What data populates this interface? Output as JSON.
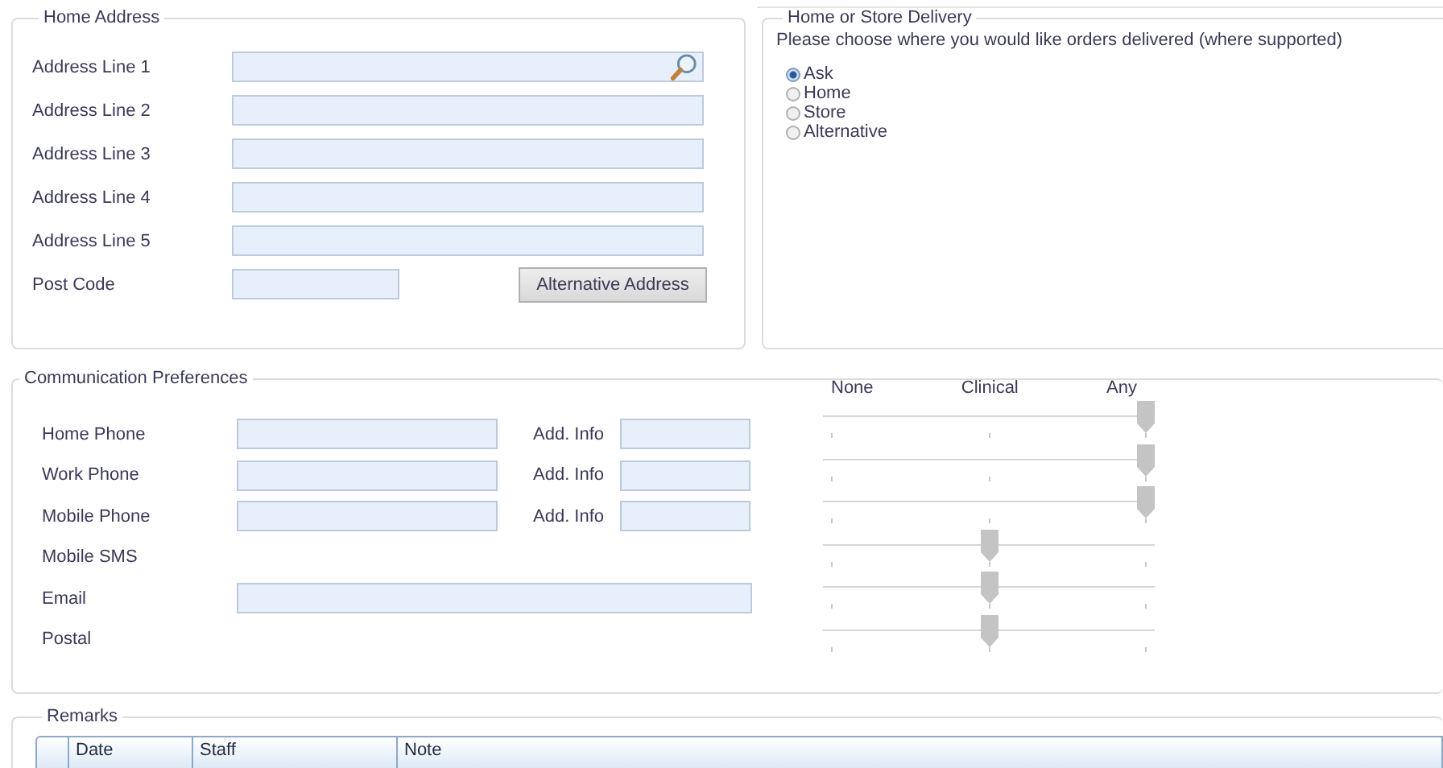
{
  "home_address": {
    "title": "Home Address",
    "fields": [
      {
        "label": "Address Line 1",
        "kind": "search"
      },
      {
        "label": "Address Line 2",
        "kind": "text"
      },
      {
        "label": "Address Line 3",
        "kind": "text"
      },
      {
        "label": "Address Line 4",
        "kind": "text"
      },
      {
        "label": "Address Line 5",
        "kind": "text"
      }
    ],
    "postcode_label": "Post Code",
    "button": "Alternative Address"
  },
  "delivery": {
    "title": "Home or Store Delivery",
    "prompt": "Please choose where you would like orders delivered (where supported)",
    "options": [
      {
        "label": "Ask",
        "selected": true
      },
      {
        "label": "Home",
        "selected": false
      },
      {
        "label": "Store",
        "selected": false
      },
      {
        "label": "Alternative",
        "selected": false
      }
    ]
  },
  "communication": {
    "title": "Communication Preferences",
    "scale": [
      "None",
      "Clinical",
      "Any"
    ],
    "rows": [
      {
        "label": "Home Phone",
        "kind": "phone",
        "info_label": "Add. Info",
        "level": 1
      },
      {
        "label": "Work Phone",
        "kind": "phone",
        "info_label": "Add. Info",
        "level": 1
      },
      {
        "label": "Mobile Phone",
        "kind": "phone",
        "info_label": "Add. Info",
        "level": 1
      },
      {
        "label": "Mobile SMS",
        "kind": "none",
        "level": 0.5
      },
      {
        "label": "Email",
        "kind": "wide",
        "level": 0.5
      },
      {
        "label": "Postal",
        "kind": "none",
        "level": 0.5
      }
    ]
  },
  "remarks": {
    "title": "Remarks",
    "columns": [
      "Date",
      "Staff",
      "Note"
    ]
  }
}
